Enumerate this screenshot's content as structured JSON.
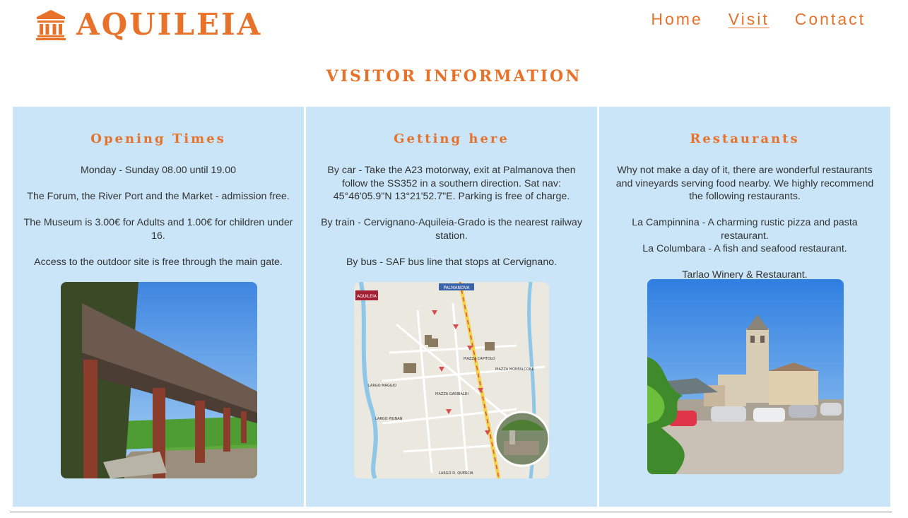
{
  "brand": {
    "name": "AQUILEIA",
    "icon": "museum-icon",
    "color": "#e8722a"
  },
  "nav": [
    {
      "label": "Home",
      "active": false
    },
    {
      "label": "Visit",
      "active": true
    },
    {
      "label": "Contact",
      "active": false
    }
  ],
  "page_title": "VISITOR INFORMATION",
  "colors": {
    "accent": "#e8722a",
    "card_bg": "#c9e5f7",
    "text": "#333333"
  },
  "cards": [
    {
      "title": "Opening Times",
      "paragraphs": [
        "Monday - Sunday 08.00 until 19.00",
        "The Forum, the River Port and the Market - admission free.",
        "The Museum is 3.00€ for Adults and 1.00€ for children under 16.",
        "Access to the outdoor site is free through the main gate."
      ],
      "image": "roman-columns-photo"
    },
    {
      "title": "Getting here",
      "paragraphs": [
        "By car - Take the A23 motorway, exit at Palmanova then follow the SS352 in a southern direction. Sat nav: 45°46'05.9\"N 13°21'52.7\"E. Parking is free of charge.",
        "By train - Cervignano-Aquileia-Grado is the nearest railway station.",
        "By bus - SAF bus line that stops at Cervignano."
      ],
      "image": "town-map",
      "map": {
        "badge": "AQUILEIA",
        "header": "PALMANOVA",
        "square_1": "PIAZZA CAPITOLO",
        "square_2": "PIAZZA GARIBALDI",
        "square_3": "PIAZZA MONFALCONE",
        "street_1": "LARGO MAGGIO",
        "street_2": "LARGO PIGNAN",
        "street_3": "LARGO D. QUERCIA"
      }
    },
    {
      "title": "Restaurants",
      "paragraphs": [
        "Why not make a day of it, there are wonderful restaurants and vineyards serving food nearby. We highly recommend the following restaurants.",
        "La Campinnina - A charming rustic pizza and pasta restaurant.",
        "La Columbara - A fish and seafood restaurant.",
        "Tarlao Winery & Restaurant."
      ],
      "image": "basilica-square-photo"
    }
  ]
}
